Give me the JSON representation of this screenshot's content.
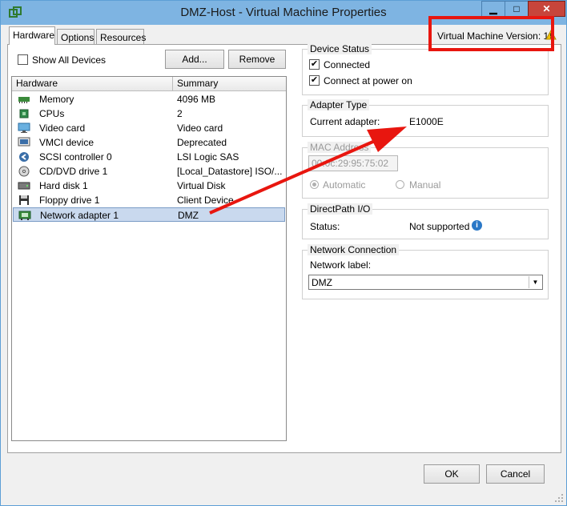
{
  "window": {
    "title": "DMZ-Host - Virtual Machine Properties",
    "minimize_glyph": "▁",
    "maximize_glyph": "□",
    "close_glyph": "✕"
  },
  "tabs": [
    {
      "label": "Hardware"
    },
    {
      "label": "Options"
    },
    {
      "label": "Resources"
    }
  ],
  "vm_version": {
    "text": "Virtual Machine Version: 11",
    "warning_icon": "warning-triangle-icon"
  },
  "toolbar": {
    "show_all_devices_label": "Show All Devices",
    "add_label": "Add...",
    "remove_label": "Remove"
  },
  "hardware_list": {
    "columns": [
      "Hardware",
      "Summary"
    ],
    "rows": [
      {
        "icon": "memory-icon",
        "name": "Memory",
        "summary": "4096 MB"
      },
      {
        "icon": "cpu-icon",
        "name": "CPUs",
        "summary": "2"
      },
      {
        "icon": "video-card-icon",
        "name": "Video card",
        "summary": "Video card"
      },
      {
        "icon": "vmci-device-icon",
        "name": "VMCI device",
        "summary": "Deprecated"
      },
      {
        "icon": "scsi-controller-icon",
        "name": "SCSI controller 0",
        "summary": "LSI Logic SAS"
      },
      {
        "icon": "cd-dvd-icon",
        "name": "CD/DVD drive 1",
        "summary": "[Local_Datastore] ISO/..."
      },
      {
        "icon": "hard-disk-icon",
        "name": "Hard disk 1",
        "summary": "Virtual Disk"
      },
      {
        "icon": "floppy-icon",
        "name": "Floppy drive 1",
        "summary": "Client Device"
      },
      {
        "icon": "network-adapter-icon",
        "name": "Network adapter 1",
        "summary": "DMZ"
      }
    ],
    "selected_row": "Network adapter 1"
  },
  "device_status": {
    "title": "Device Status",
    "connected_label": "Connected",
    "connected_checked": true,
    "connect_power_on_label": "Connect at power on",
    "connect_power_on_checked": true
  },
  "adapter_type": {
    "title": "Adapter Type",
    "current_label": "Current adapter:",
    "current_value": "E1000E"
  },
  "mac_address": {
    "title": "MAC Address",
    "value": "00:0c:29:95:75:02",
    "automatic_label": "Automatic",
    "manual_label": "Manual"
  },
  "directpath": {
    "title": "DirectPath I/O",
    "status_label": "Status:",
    "status_value": "Not supported"
  },
  "network_connection": {
    "title": "Network Connection",
    "label": "Network label:",
    "selected": "DMZ"
  },
  "footer": {
    "ok_label": "OK",
    "cancel_label": "Cancel"
  },
  "colors": {
    "titlebar": "#7eb4e2",
    "annotation_red": "#e8160f",
    "selected_row": "#c9d9ee"
  }
}
